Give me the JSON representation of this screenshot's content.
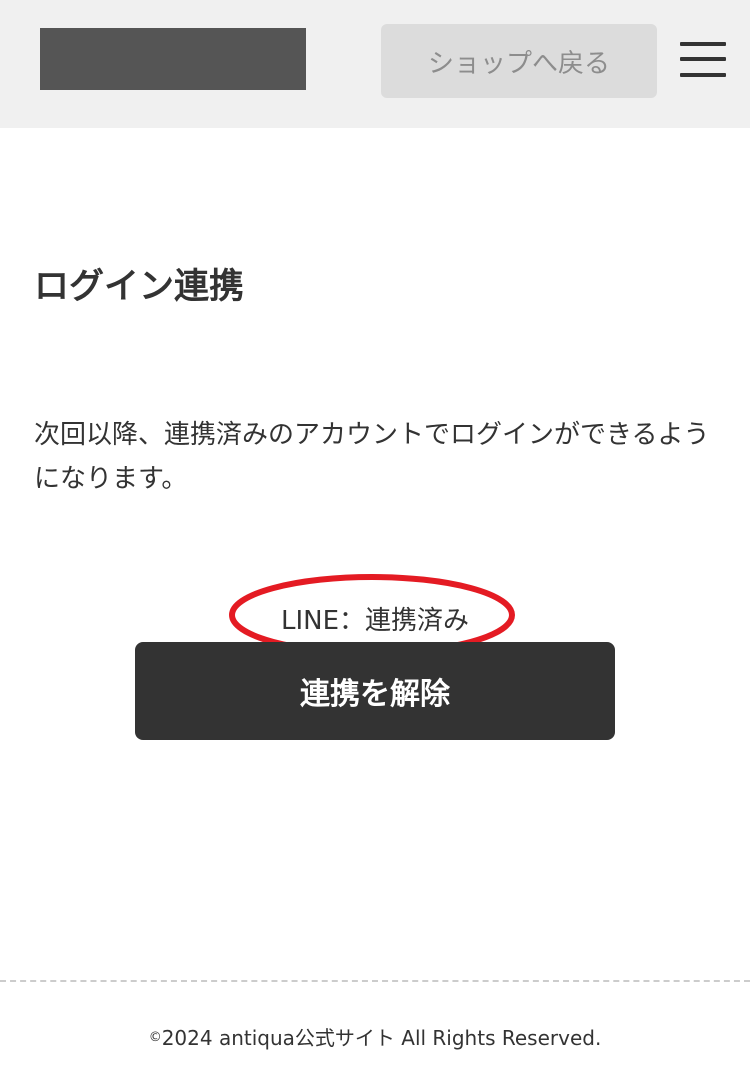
{
  "header": {
    "shop_button_label": "ショップへ戻る",
    "menu_icon": "hamburger-menu-icon"
  },
  "main": {
    "title": "ログイン連携",
    "description": "次回以降、連携済みのアカウントでログインができるようになります。",
    "status_text": "LINE：連携済み",
    "unlink_button_label": "連携を解除"
  },
  "footer": {
    "copyright_symbol": "©",
    "copyright_text": "2024 antiqua公式サイト All Rights Reserved."
  },
  "colors": {
    "header_background": "#f0f0f0",
    "logo_placeholder": "#555555",
    "primary_dark": "#333333",
    "highlight_oval": "#e41b23"
  }
}
